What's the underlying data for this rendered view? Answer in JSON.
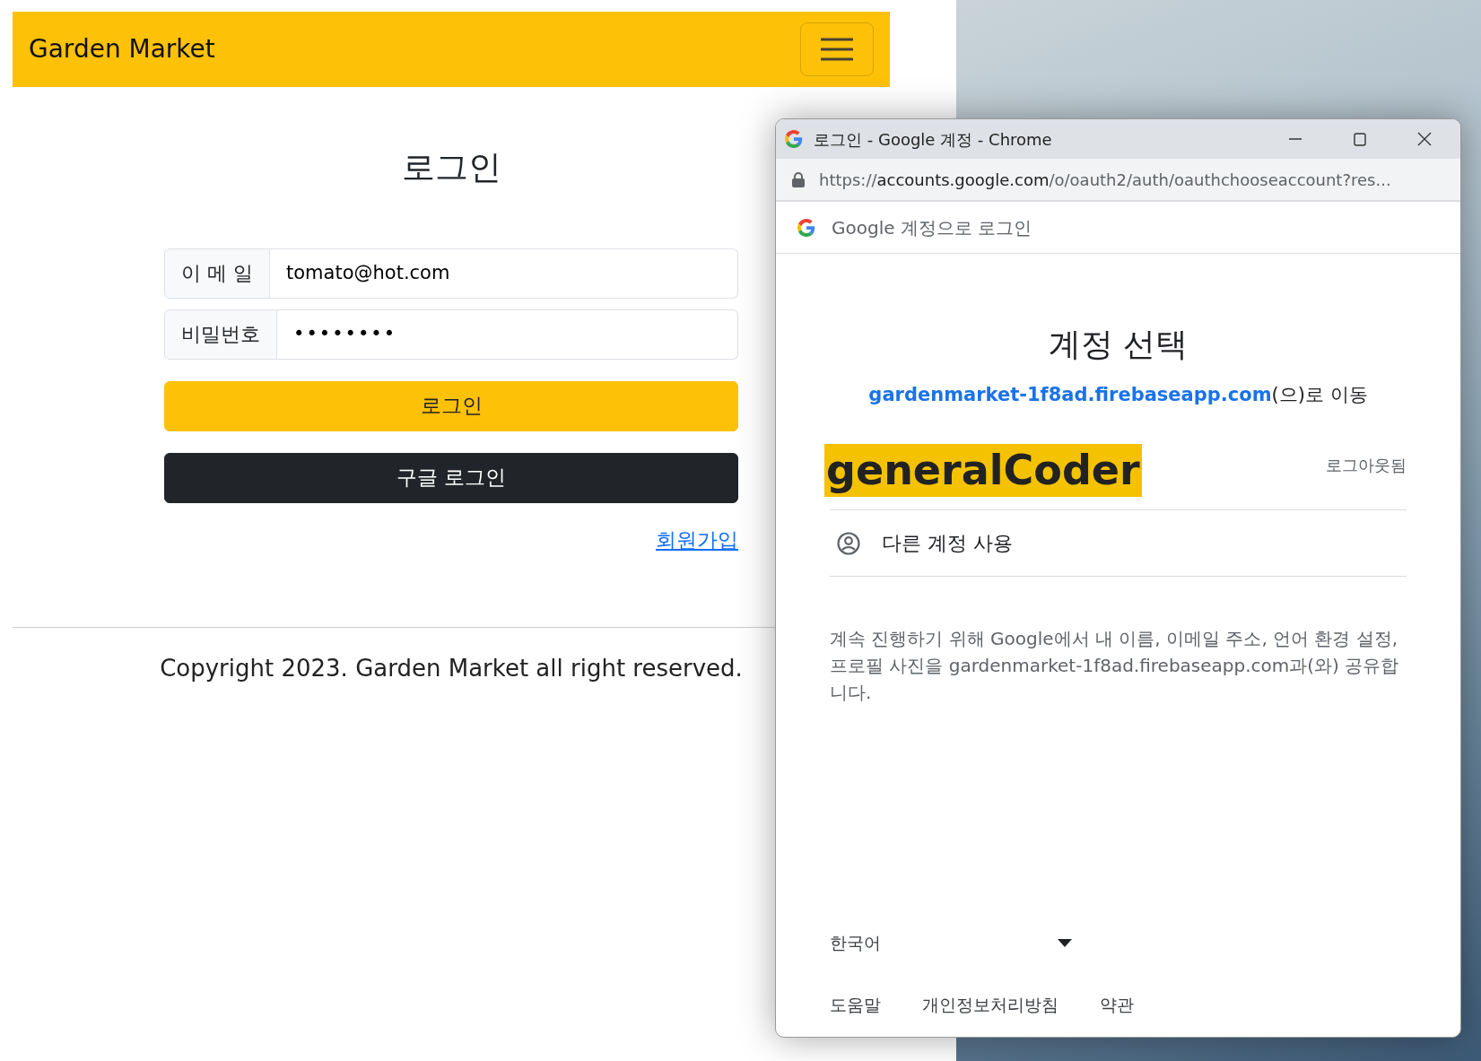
{
  "navbar": {
    "brand": "Garden Market"
  },
  "login": {
    "title": "로그인",
    "fields": [
      {
        "label": "이 메 일",
        "value": "tomato@hot.com"
      },
      {
        "label": "비밀번호",
        "value": "••••••••"
      }
    ],
    "buttons": [
      {
        "label": "로그인",
        "kind": "primary"
      },
      {
        "label": "구글 로그인",
        "kind": "dark"
      }
    ],
    "signup_link": "회원가입"
  },
  "footer": {
    "copyright": "Copyright 2023. Garden Market all right reserved."
  },
  "popup": {
    "window_title": "로그인 - Google 계정 - Chrome",
    "url": "https://accounts.google.com/o/oauth2/auth/oauthchooseaccount?res...",
    "header": "Google 계정으로 로그인",
    "heading": "계정 선택",
    "continue_link": "gardenmarket-1f8ad.firebaseapp.com",
    "continue_suffix": "(으)로 이동",
    "accounts": [
      {
        "name": "generalCoder",
        "status": "로그아웃됨"
      }
    ],
    "other_account": "다른 계정 사용",
    "consent": "계속 진행하기 위해 Google에서 내 이름, 이메일 주소, 언어 환경 설정, 프로필 사진을 gardenmarket-1f8ad.firebaseapp.com과(와) 공유합니다.",
    "language": "한국어",
    "footer_links": [
      "도움말",
      "개인정보처리방침",
      "약관"
    ]
  }
}
